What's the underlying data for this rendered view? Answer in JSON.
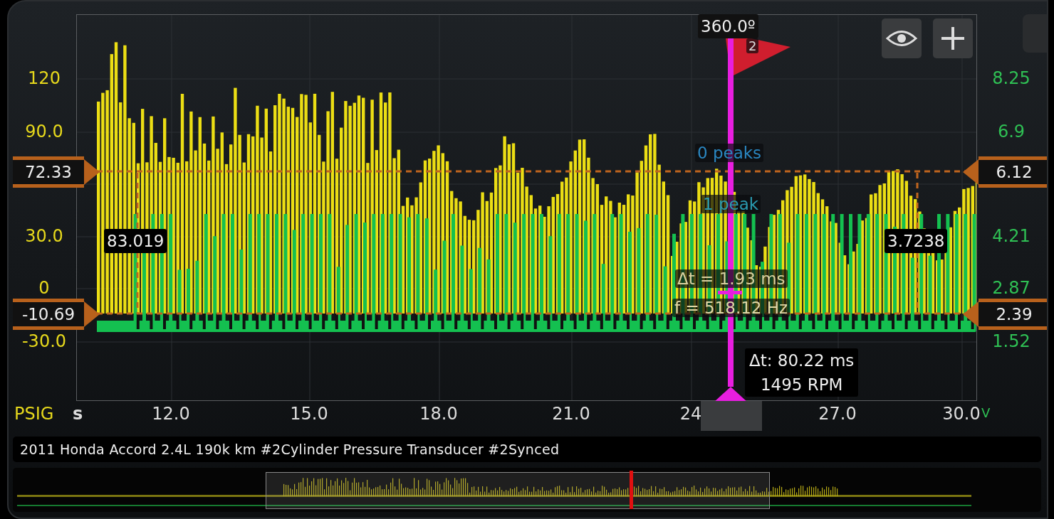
{
  "plot": {
    "left_unit": "PSIG",
    "x_unit": "s",
    "right_unit": "V",
    "left_ticks": [
      "120",
      "90.0",
      "30.0",
      "0",
      "-30.0"
    ],
    "right_ticks": [
      "8.25",
      "6.9",
      "4.21",
      "2.87",
      "1.52"
    ],
    "x_ticks": [
      "12.0",
      "15.0",
      "18.0",
      "21.0",
      "24",
      "27.0",
      "30.0"
    ]
  },
  "cursors": {
    "left_upper": "72.33",
    "left_lower": "-10.69",
    "right_upper": "6.12",
    "right_lower": "2.39",
    "left_reading": "83.019",
    "right_reading": "3.7238"
  },
  "trigger": {
    "angle": "360.0º",
    "flag": "2"
  },
  "measurements": {
    "peaks_upper": "0 peaks",
    "peaks_lower": "1 peak",
    "delta_t": "Δt = 1.93 ms",
    "frequency": "f = 518.12 Hz",
    "cursor_delta": "Δt: 80.22 ms",
    "rpm": "1495 RPM"
  },
  "title": "2011 Honda Accord 2.4L 190k km #2Cylinder Pressure Transducer #2Synced"
}
